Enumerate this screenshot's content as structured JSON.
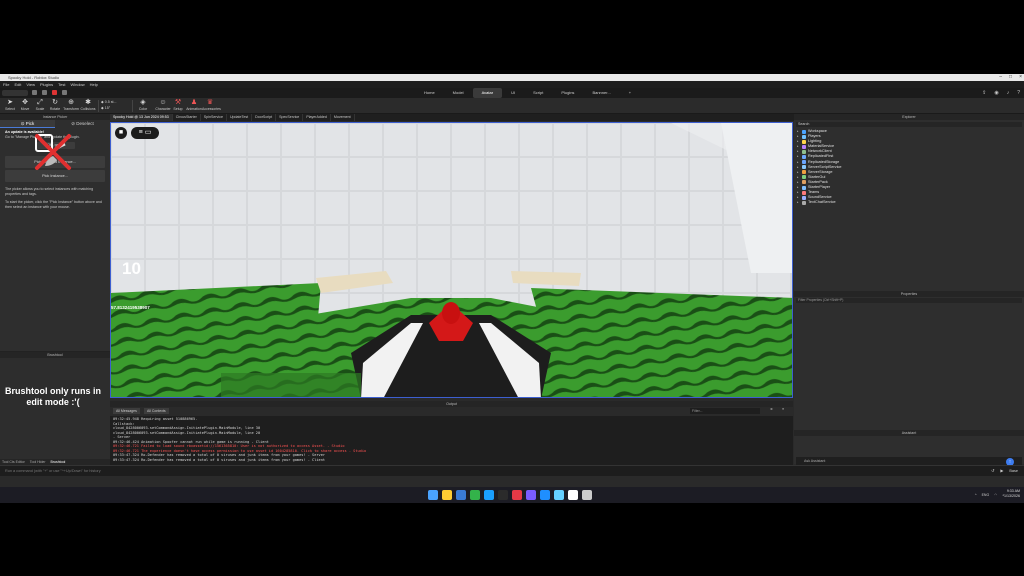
{
  "window": {
    "title": "Spooky Hold - Roblox Studio"
  },
  "menubar": [
    "File",
    "Edit",
    "View",
    "Plugins",
    "Test",
    "Window",
    "Help"
  ],
  "ribbon_tabs": [
    "Home",
    "Model",
    "Avatar",
    "UI",
    "Script",
    "Plugins",
    "Bannner...",
    "+"
  ],
  "active_ribbon_tab": "Avatar",
  "toolbar": {
    "tools": [
      "Select",
      "Move",
      "Scale",
      "Rotate",
      "Transform",
      "Collisions",
      "",
      "Color",
      "Character",
      "Setup",
      "Animation",
      "Accessories"
    ],
    "step_a": "0.5 st...",
    "step_b": "15°"
  },
  "doc_tabs": [
    "Spooky Hold @ 13 Jun 2024 09:53",
    "CircusStarter",
    "SpinService",
    "UpdateTest",
    "DoorScript",
    "SpecService",
    "PlayerAdded",
    "Movement"
  ],
  "instance_picker": {
    "header": "Instance Picker",
    "tab_pick": "Pick",
    "tab_deselect": "Deselect",
    "update_title": "An update is available!",
    "update_body": "Go to \"Manage Plugins\" and update the plugin.",
    "ok_button": "OK, got it",
    "pick_selected": "Pick Selected Instance...",
    "pick_instance": "Pick Instance...",
    "help1": "The picker allows you to select instances with matching properties and tags.",
    "help2": "To start the picker, click the \"Pick Instance\" button above and then select an instance with your mouse."
  },
  "brushtool": {
    "header": "Brushtool",
    "message": "Brushtool only runs in edit mode :'("
  },
  "bottom_tabs": [
    "Tool Cts Editor",
    "Tool Hider",
    "Brushtool"
  ],
  "viewport": {
    "counter": "10",
    "small_value": "57.8132419538907"
  },
  "output": {
    "header": "Output",
    "filter_messages": "All Messages",
    "filter_contexts": "All Contexts",
    "filter_placeholder": "Filter...",
    "lines": [
      {
        "text": "09:32:45.948  Requiring asset 510886965.",
        "kind": "info"
      },
      {
        "text": "Callstack:",
        "kind": "info"
      },
      {
        "text": "cloud_8428006093.setCommandAssign.InitiatePlugin.MainModule, line 30",
        "kind": "info"
      },
      {
        "text": "cloud_8428006093.setCommandAssign.InitiatePlugin.MainModule, line 20",
        "kind": "info"
      },
      {
        "text": "  -  Server",
        "kind": "info"
      },
      {
        "text": "09:32:46.424  Animation Spoofer cannot run while game is running  -  Client",
        "kind": "info"
      },
      {
        "text": "09:32:46.721  Failed to load sound rbxassetid://1561365810: User is not authorized to access Asset.  -  Studio",
        "kind": "err"
      },
      {
        "text": "09:32:46.721  The experience doesn't have access permission to use asset id 1604285810. Click to share access  -  Studio",
        "kind": "err"
      },
      {
        "text": "09:33:47.324  Ro-Defender has removed a total of 0 viruses and junk items from your games!  -  Server",
        "kind": "info"
      },
      {
        "text": "09:33:47.324  Ro-Defender has removed a total of 0 viruses and junk items from your games!  -  Client",
        "kind": "info"
      }
    ]
  },
  "explorer": {
    "header": "Explorer",
    "search_placeholder": "Search",
    "items": [
      {
        "label": "Workspace",
        "color": "#4aa3ff"
      },
      {
        "label": "Players",
        "color": "#6ec1ff"
      },
      {
        "label": "Lighting",
        "color": "#ffd64a"
      },
      {
        "label": "MaterialService",
        "color": "#b880ff"
      },
      {
        "label": "NetworkClient",
        "color": "#8fbf8f"
      },
      {
        "label": "ReplicatedFirst",
        "color": "#6ba6ff"
      },
      {
        "label": "ReplicatedStorage",
        "color": "#6ba6ff"
      },
      {
        "label": "ServerScriptService",
        "color": "#88c9ff"
      },
      {
        "label": "ServerStorage",
        "color": "#f0a040"
      },
      {
        "label": "StarterGui",
        "color": "#7fd07f"
      },
      {
        "label": "StarterPack",
        "color": "#e0a060"
      },
      {
        "label": "StarterPlayer",
        "color": "#7fc0ff"
      },
      {
        "label": "Teams",
        "color": "#ff7b7b"
      },
      {
        "label": "SoundService",
        "color": "#9ab0ff"
      },
      {
        "label": "TextChatService",
        "color": "#aaa"
      }
    ]
  },
  "properties": {
    "header": "Properties",
    "filter_placeholder": "Filter Properties (Ctrl+Shift+P)"
  },
  "assistant": {
    "header": "Assistant",
    "ask_placeholder": "Ask Assistant"
  },
  "command_bar": {
    "placeholder": "Run a command (with \"+\" or use \"^+Up/Down\" for history",
    "mode": "Base"
  },
  "taskbar": {
    "icon_colors": [
      "#4aa3ff",
      "#ffcc33",
      "#3a7bd5",
      "#33b34a",
      "#1a9fff",
      "#2b2b2b",
      "#e63946",
      "#7a5cff",
      "#1f8fff",
      "#66d0ff",
      "#ffffff",
      "#cccccc"
    ],
    "lang": "ENG",
    "time": "9:33 AM",
    "date": "1/13/2026"
  }
}
